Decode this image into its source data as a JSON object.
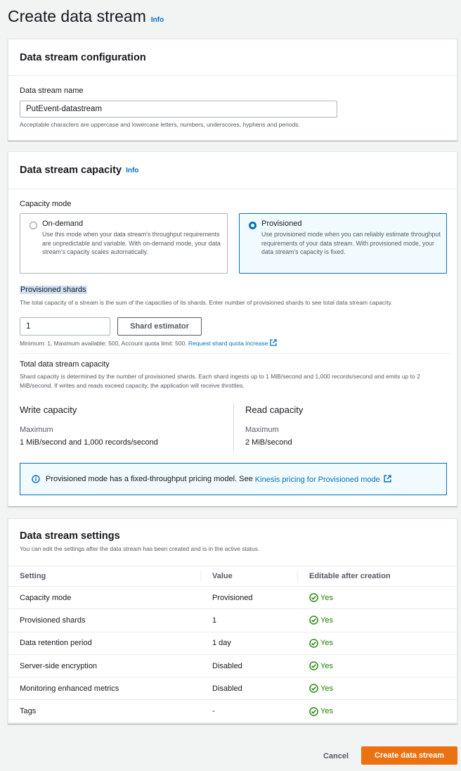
{
  "header": {
    "title": "Create data stream",
    "info": "Info"
  },
  "config": {
    "title": "Data stream configuration",
    "name_label": "Data stream name",
    "name_value": "PutEvent-datastream",
    "name_hint": "Acceptable characters are uppercase and lowercase letters, numbers, underscores, hyphens and periods."
  },
  "capacity": {
    "title": "Data stream capacity",
    "info": "Info",
    "mode_label": "Capacity mode",
    "on_demand": {
      "title": "On-demand",
      "desc": "Use this mode when your data stream's throughput requirements are unpredictable and variable. With on-demand mode, your data stream's capacity scales automatically."
    },
    "provisioned": {
      "title": "Provisioned",
      "desc": "Use provisioned mode when you can reliably estimate throughput requirements of your data stream. With provisioned mode, your data stream's capacity is fixed."
    },
    "selected_mode": "Provisioned",
    "shards_label": "Provisioned shards",
    "shards_desc": "The total capacity of a stream is the sum of the capacities of its shards. Enter number of provisioned shards to see total data stream capacity.",
    "shards_value": "1",
    "estimator_button": "Shard estimator",
    "shards_limits": "Minimum: 1, Maximum available: 500, Account quota limit: 500.",
    "quota_link": "Request shard quota increase",
    "total_title": "Total data stream capacity",
    "total_desc": "Shard capacity is determined by the number of provisioned shards. Each shard ingests up to 1 MiB/second and 1,000 records/second and emits up to 2 MiB/second. If writes and reads exceed capacity, the application will receive throttles.",
    "write": {
      "title": "Write capacity",
      "label": "Maximum",
      "value": "1 MiB/second and 1,000 records/second"
    },
    "read": {
      "title": "Read capacity",
      "label": "Maximum",
      "value": "2 MiB/second"
    },
    "alert_text": "Provisioned mode has a fixed-throughput pricing model. See",
    "alert_link": "Kinesis pricing for Provisioned mode"
  },
  "settings": {
    "title": "Data stream settings",
    "subtitle": "You can edit the settings after the data stream has been created and is in the active status.",
    "columns": [
      "Setting",
      "Value",
      "Editable after creation"
    ],
    "rows": [
      {
        "setting": "Capacity mode",
        "value": "Provisioned",
        "editable": "Yes"
      },
      {
        "setting": "Provisioned shards",
        "value": "1",
        "editable": "Yes"
      },
      {
        "setting": "Data retention period",
        "value": "1 day",
        "editable": "Yes"
      },
      {
        "setting": "Server-side encryption",
        "value": "Disabled",
        "editable": "Yes"
      },
      {
        "setting": "Monitoring enhanced metrics",
        "value": "Disabled",
        "editable": "Yes"
      },
      {
        "setting": "Tags",
        "value": "-",
        "editable": "Yes"
      }
    ]
  },
  "footer": {
    "cancel": "Cancel",
    "create": "Create data stream"
  }
}
